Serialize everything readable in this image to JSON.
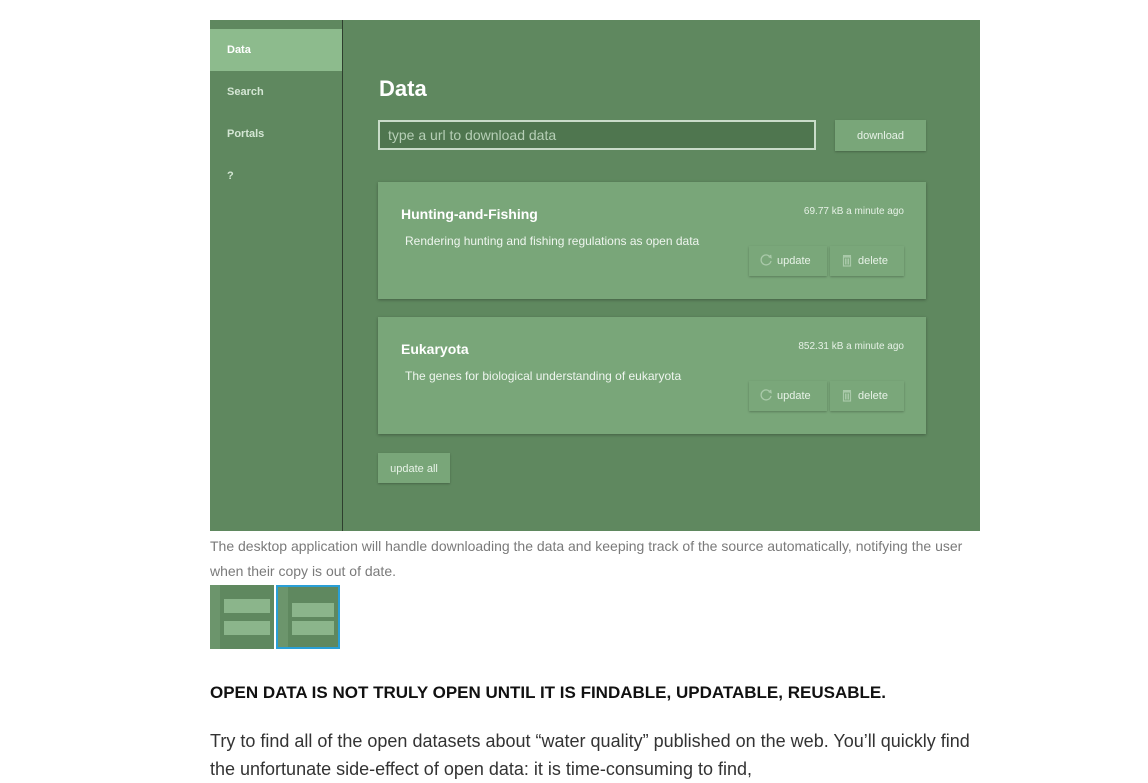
{
  "sidebar": {
    "items": [
      {
        "label": "Data",
        "active": true
      },
      {
        "label": "Search"
      },
      {
        "label": "Portals"
      },
      {
        "label": "?"
      }
    ]
  },
  "main": {
    "title": "Data",
    "url_input": {
      "placeholder": "type a url to download data",
      "value": ""
    },
    "download_label": "download",
    "datasets": [
      {
        "name": "Hunting-and-Fishing",
        "meta": "69.77 kB a minute ago",
        "description": "Rendering hunting and fishing regulations as open data",
        "update_label": "update",
        "delete_label": "delete"
      },
      {
        "name": "Eukaryota",
        "meta": "852.31 kB a minute ago",
        "description": "The genes for biological understanding of eukaryota",
        "update_label": "update",
        "delete_label": "delete"
      }
    ],
    "update_all_label": "update all"
  },
  "caption": "The desktop application will handle downloading the data and keeping track of the source automatically, notifying the user when their copy is out of date.",
  "article": {
    "heading": "OPEN DATA IS NOT TRULY OPEN UNTIL IT IS FINDABLE, UPDATABLE, REUSABLE.",
    "paragraph": "Try to find all of the open datasets about “water quality” published on the web. You’ll quickly find the unfortunate side-effect of open data: it is time-consuming to find,"
  },
  "colors": {
    "app_bg": "#5f885f",
    "active_nav": "#8dbb8d",
    "card_bg": "#79a679",
    "thumb_selected_border": "#2a9fd6"
  },
  "icons": [
    "refresh-icon",
    "trash-icon"
  ]
}
